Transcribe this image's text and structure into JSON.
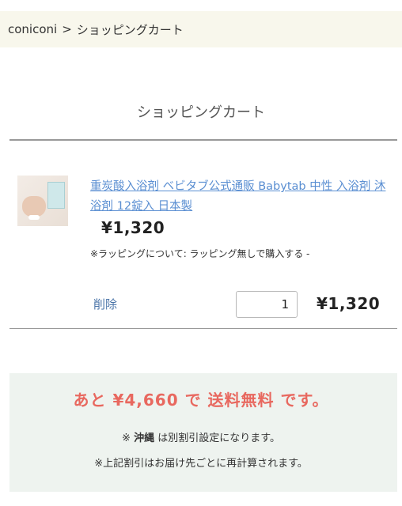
{
  "breadcrumb": {
    "home": "coniconi",
    "separator": ">",
    "current": "ショッピングカート"
  },
  "page_title": "ショッピングカート",
  "cart_item": {
    "image_icon": "product-thumbnail",
    "name": "重炭酸入浴剤 ベビタブ公式通販 Babytab 中性 入浴剤 沐浴剤 12錠入 日本製",
    "unit_price": "¥1,320",
    "wrapping_note": "※ラッピングについて: ラッピング無しで購入する -",
    "delete_label": "削除",
    "quantity": "1",
    "line_total": "¥1,320"
  },
  "shipping": {
    "message": "あと ¥4,660 で 送料無料 です。",
    "note1_mark": "※",
    "note1_bold": "沖縄",
    "note1_rest": "は別割引設定になります。",
    "note2": "※上記割引はお届け先ごとに再計算されます。"
  },
  "colors": {
    "breadcrumb_bg": "#f8f7ec",
    "link": "#5b8fd2",
    "accent_red": "#e8685f",
    "shipping_bg": "#eef3ef"
  }
}
